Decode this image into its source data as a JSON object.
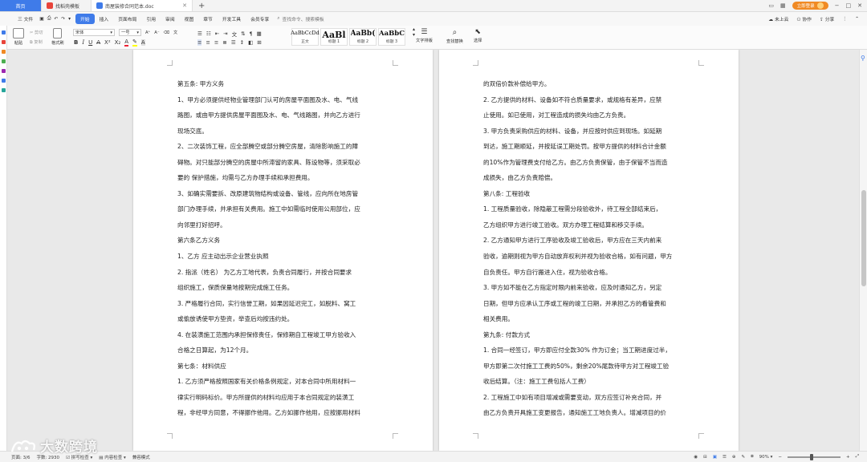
{
  "titlebar": {
    "tabs": [
      {
        "label": "首页",
        "active": false
      },
      {
        "label": "找稻壳模板",
        "active": false
      },
      {
        "label": "南屋装修合同范本.doc",
        "active": true
      }
    ],
    "new_tab": "+",
    "login_label": "立即登录",
    "window_controls": [
      "−",
      "□",
      "✕"
    ]
  },
  "menubar": {
    "items": [
      "三 文件",
      "开始",
      "插入",
      "页面布局",
      "引用",
      "审阅",
      "视图",
      "章节",
      "开发工具",
      "会员专享"
    ],
    "active": "开始",
    "search_placeholder": "查找命令、搜索模板",
    "right": [
      "未上云",
      "协作",
      "分享"
    ]
  },
  "ribbon": {
    "paste": "粘贴",
    "cut": "剪切",
    "copy": "复制",
    "format_painter": "格式刷",
    "font_name": "宋体",
    "font_size": "一号",
    "styles": [
      {
        "sample": "AaBbCcDd",
        "name": "正文"
      },
      {
        "sample": "AaBl",
        "name": "标题 1"
      },
      {
        "sample": "AaBb(",
        "name": "标题 2"
      },
      {
        "sample": "AaBbC",
        "name": "标题 3"
      }
    ],
    "text_layout": "文字排版",
    "find_replace": "查找替换",
    "select": "选择"
  },
  "page_left": {
    "lines": [
      {
        "t": "第五条:  甲方义务",
        "ind": false
      },
      {
        "t": "1、甲方必须提供经物业管理部门认可的房屋平面图及水、电、气线",
        "ind": false
      },
      {
        "t": "路图，或由甲方提供房屋平面图及水、电、气线路图，并向乙方进行",
        "ind": false
      },
      {
        "t": "现场交底。",
        "ind": false
      },
      {
        "t": "2、二次装饰工程，应全部腾空或部分腾空房屋，清除影响施工的障",
        "ind": false
      },
      {
        "t": "碍物。对只能部分腾空的房屋中所滞留的家具、陈设物等，须采取必",
        "ind": false
      },
      {
        "t": "要的  保护措施，均需与乙方办理手续和承担费用。",
        "ind": false
      },
      {
        "t": "3、如确实需要拆、改原建筑物结构或设备、管线，应向所在地房管",
        "ind": false
      },
      {
        "t": "部门办理手续，并承担有关费用。施工中如需临时使用公用部位，应",
        "ind": false
      },
      {
        "t": "向邻里打好招呼。",
        "ind": false
      },
      {
        "t": "第六条乙方义务",
        "ind": false
      },
      {
        "t": "1、乙方 应主动出示企业营业执照",
        "ind": false
      },
      {
        "t": "2.   指派（姓名）  为乙方工地代表，负责合同履行，并按合同要求",
        "ind": false
      },
      {
        "t": "组织施工，保质保量地按期完成施工任务。",
        "ind": false
      },
      {
        "t": "3.   严格履行合同，实行信誉工期，如果因延迟完工，如脱料、窝工",
        "ind": false
      },
      {
        "t": "或偷放诱使甲方垫资，举查后均按违约处。",
        "ind": false
      },
      {
        "t": "4. 在装潢施工范围内承担保修责任，保修期自工程竣工甲方验收入",
        "ind": false
      },
      {
        "t": "合格之日算起，为12个月。",
        "ind": false
      },
      {
        "t": "第七条：材料供应",
        "ind": false
      },
      {
        "t": "1.   乙方须严格按照国家有关价格条例规定，对本合同中所用材料一",
        "ind": false
      },
      {
        "t": "律实行明码标价。甲方所提供的材料均应用于本合同规定的装潢工",
        "ind": false
      },
      {
        "t": "程，非经甲方同意，不得挪作他用。乙方如挪作他用，应按挪用材料",
        "ind": false
      }
    ]
  },
  "page_right": {
    "lines": [
      {
        "t": "的双倍价款补偿给甲方。",
        "ind": false
      },
      {
        "t": "2.   乙方提供的材料、设备如不符合质量要求，或规格有差异，应禁",
        "ind": false
      },
      {
        "t": "止使用。如已使用，对工程造成的损失均由乙方负责。",
        "ind": false
      },
      {
        "t": "3.   甲方负责采购供应的材料、设备，并应按时供应到现场。如延期",
        "ind": false
      },
      {
        "t": "到达，施工期顺延，并按延误工期处罚。按甲方提供的材料合计金额",
        "ind": false
      },
      {
        "t": "的10%作为管理费支付给乙方。由乙方负责保管，由于保管不当而造",
        "ind": false
      },
      {
        "t": "成损失，由乙方负责赔偿。",
        "ind": false
      },
      {
        "t": "第八条:    工程验收",
        "ind": false
      },
      {
        "t": "1.   工程质量验收，除隐蔽工程需分段验收外，待工程全部结束后，",
        "ind": false
      },
      {
        "t": "乙方组织甲方进行竣工验收。双方办理工程结算和移交手续。",
        "ind": false
      },
      {
        "t": "2.   乙方通知甲方进行工序验收及竣工验收后，甲方应在三天内前来",
        "ind": false
      },
      {
        "t": "验收，逾期则视为甲方自动放弃权利并视为验收合格，如有问题，甲方",
        "ind": false
      },
      {
        "t": "自负责任。甲方自行搬进入住，视为验收合格。",
        "ind": false
      },
      {
        "t": "3.   甲方如不能在乙方指定时限内前来验收，应及时通知乙方，另定",
        "ind": false
      },
      {
        "t": "日期，但甲方应承认工序或工程的竣工日期，并承担乙方的看管费和",
        "ind": false
      },
      {
        "t": "相关费用。",
        "ind": false
      },
      {
        "t": "第九条:    付款方式",
        "ind": false
      },
      {
        "t": "1. 合同一经签订，甲方即应付全款30%  作为订金；当工期进度过半，",
        "ind": false
      },
      {
        "t": "甲方即第二次付施工工费的50%，剩余20%尾款待甲方对工程竣工验",
        "ind": false
      },
      {
        "t": "收后结算。（注：施工工费包括人工费）",
        "ind": false
      },
      {
        "t": "2. 工程施工中如有项目增减或需要变动，双方应签订补充合同，并",
        "ind": false
      },
      {
        "t": "由乙方负责开具施工变更报告，通知施工工地负责人。增减项目的价",
        "ind": false
      }
    ]
  },
  "statusbar": {
    "page": "页面: 3/6",
    "words": "字数: 2930",
    "spell": "拼写检查",
    "content_check": "内容检查",
    "compat": "兼容模式",
    "zoom": "90%",
    "zoom_fraction": 0.45
  },
  "watermark": {
    "text": "大数跨境"
  }
}
